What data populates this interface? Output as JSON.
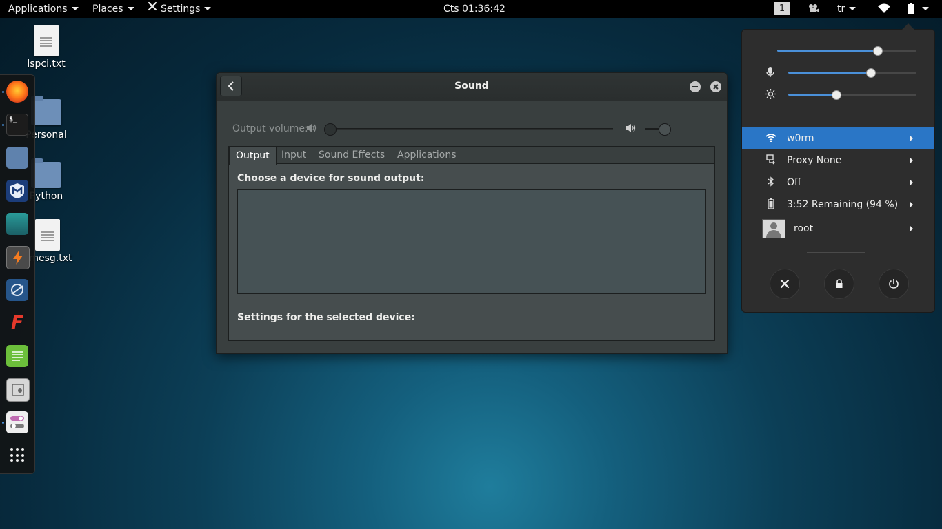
{
  "topbar": {
    "applications": "Applications",
    "places": "Places",
    "settings": "Settings",
    "clock": "Cts 01:36:42",
    "workspace": "1",
    "keyboard_layout": "tr"
  },
  "desktop": {
    "items": [
      {
        "label": "lspci.txt",
        "kind": "file"
      },
      {
        "label": "Personal",
        "kind": "folder"
      },
      {
        "label": "Python",
        "kind": "folder"
      },
      {
        "label": "dmesg.txt",
        "kind": "file"
      }
    ]
  },
  "dock": {
    "apps": [
      "firefox-icon",
      "terminal-icon",
      "files-icon",
      "metasploit-icon",
      "armitage-icon",
      "burpsuite-icon",
      "maltego-icon",
      "faraday-icon",
      "leafpad-icon",
      "cutycapt-icon",
      "settings-toggle-icon",
      "show-apps-icon"
    ],
    "terminal_glyph": "$_"
  },
  "sound_window": {
    "title": "Sound",
    "output_volume_label": "Output volume:",
    "output_volume_level": 0,
    "tabs": [
      "Output",
      "Input",
      "Sound Effects",
      "Applications"
    ],
    "active_tab": "Output",
    "choose_device_label": "Choose a device for sound output:",
    "settings_label": "Settings for the selected device:"
  },
  "system_menu": {
    "volume_level": 0.72,
    "mic_level": 0.6,
    "brightness_level": 0.35,
    "wifi": "w0rm",
    "proxy": "Proxy None",
    "bluetooth": "Off",
    "battery": "3:52 Remaining (94 %)",
    "user": "root",
    "accent": "#2a76c6"
  }
}
